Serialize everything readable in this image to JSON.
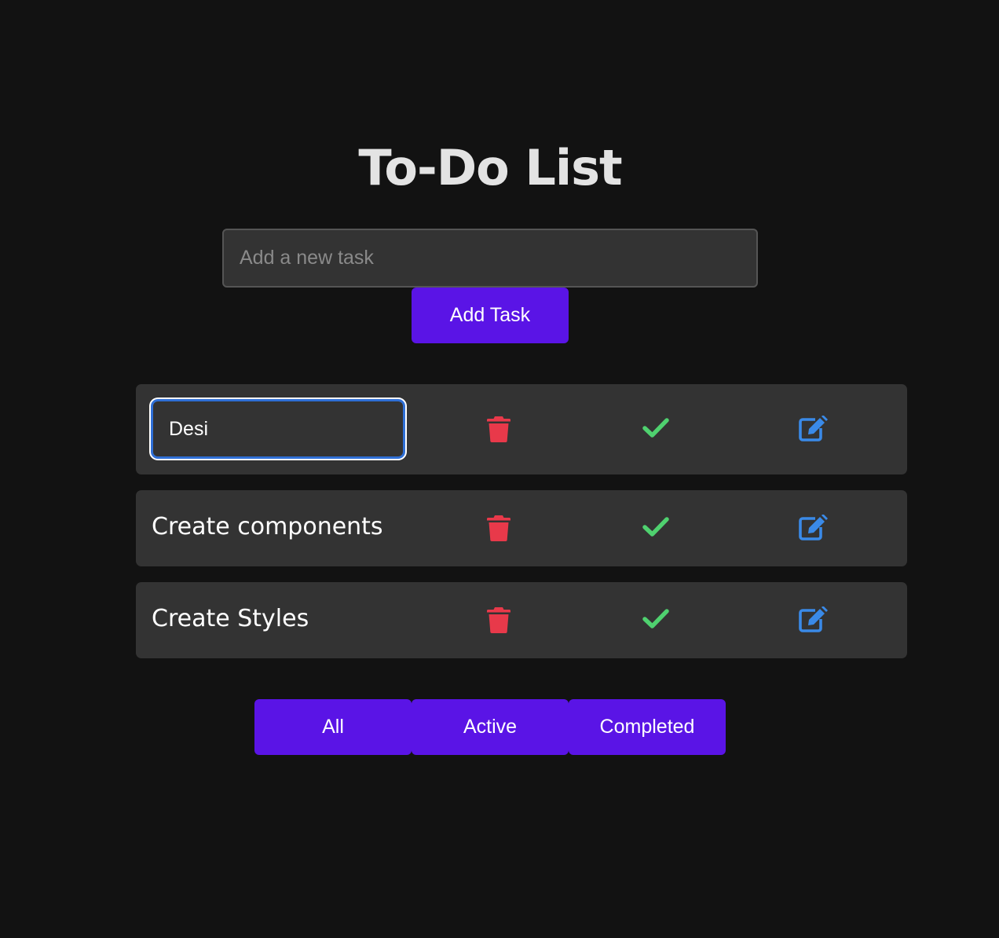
{
  "header": {
    "title": "To-Do List"
  },
  "new_task": {
    "placeholder": "Add a new task",
    "value": "",
    "add_button_label": "Add Task"
  },
  "tasks": [
    {
      "text": "Desi",
      "editing": true
    },
    {
      "text": "Create components",
      "editing": false
    },
    {
      "text": "Create Styles",
      "editing": false
    }
  ],
  "task_actions": {
    "delete_icon": "trash-icon",
    "complete_icon": "check-icon",
    "edit_icon": "edit-icon"
  },
  "filters": {
    "all": "All",
    "active": "Active",
    "completed": "Completed"
  },
  "colors": {
    "background": "#121212",
    "surface": "#333333",
    "accent": "#5a14e6",
    "delete": "#e8394a",
    "complete": "#4fd16f",
    "edit": "#3a8ae8",
    "title": "#e3e3e3"
  }
}
